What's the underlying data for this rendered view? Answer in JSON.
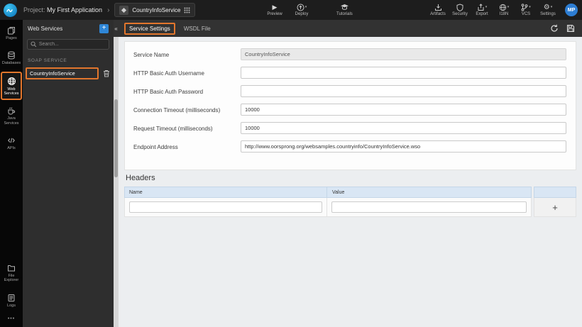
{
  "topbar": {
    "project_label": "Project:",
    "project_name": "My First Application",
    "app_selector": {
      "name": "CountryInfoService"
    },
    "center_actions": [
      {
        "label": "Preview"
      },
      {
        "label": "Deploy"
      },
      {
        "label": "Tutorials"
      }
    ],
    "right_actions": [
      {
        "label": "Artifacts"
      },
      {
        "label": "Security"
      },
      {
        "label": "Export"
      },
      {
        "label": "I18N"
      },
      {
        "label": "VCS"
      },
      {
        "label": "Settings"
      }
    ],
    "avatar_initials": "MP"
  },
  "rail": {
    "items": [
      {
        "label": "Pages"
      },
      {
        "label": "Databases"
      },
      {
        "label": "Web Services"
      },
      {
        "label": "Java Services"
      },
      {
        "label": "APIs"
      }
    ],
    "bottom_items": [
      {
        "label": "File Explorer"
      },
      {
        "label": "Logs"
      }
    ]
  },
  "panel": {
    "title": "Web Services",
    "search_placeholder": "Search...",
    "section_label": "SOAP SERVICE",
    "service_name": "CountryInfoService"
  },
  "tabs": {
    "active": "Service Settings",
    "inactive": "WSDL File"
  },
  "form": {
    "fields": [
      {
        "label": "Service Name",
        "value": "CountryInfoService"
      },
      {
        "label": "HTTP Basic Auth Username",
        "value": ""
      },
      {
        "label": "HTTP Basic Auth Password",
        "value": ""
      },
      {
        "label": "Connection Timeout (milliseconds)",
        "value": "10000"
      },
      {
        "label": "Request Timeout (milliseconds)",
        "value": "10000"
      },
      {
        "label": "Endpoint Address",
        "value": "http://www.oorsprong.org/websamples.countryinfo/CountryInfoService.wso"
      }
    ]
  },
  "headers_table": {
    "title": "Headers",
    "columns": [
      "Name",
      "Value"
    ],
    "add_label": "+",
    "rows": [
      {
        "name": "",
        "value": ""
      }
    ]
  },
  "icons": {
    "collapse": "«",
    "breadcrumb_chevron": "›",
    "play": "▶",
    "caret": "▾",
    "gear": "⚙",
    "add": "+",
    "ellipsis": "•••"
  },
  "colors": {
    "highlight_orange": "#e2762d",
    "add_button_blue": "#2f86d6",
    "table_header_blue": "#d9e6f4",
    "avatar_blue": "#2d7dd2"
  }
}
